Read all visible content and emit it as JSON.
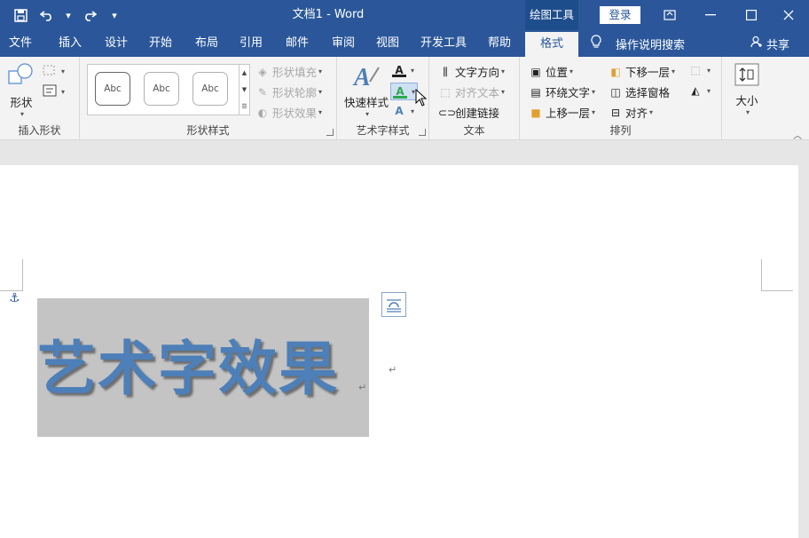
{
  "titlebar": {
    "doc_title": "文档1  -  Word",
    "context_tab": "绘图工具",
    "login": "登录"
  },
  "tabs": [
    "文件",
    "插入",
    "设计",
    "开始",
    "布局",
    "引用",
    "邮件",
    "审阅",
    "视图",
    "开发工具",
    "帮助",
    "格式"
  ],
  "active_tab": "格式",
  "tell_me": "操作说明搜索",
  "share": "共享",
  "ribbon": {
    "insert_shapes": {
      "shapes_label": "形状",
      "group_label": "插入形状"
    },
    "shape_styles": {
      "gallery": [
        "Abc",
        "Abc",
        "Abc"
      ],
      "fill": "形状填充",
      "outline": "形状轮廓",
      "effects": "形状效果",
      "group_label": "形状样式"
    },
    "wordart": {
      "quick_styles": "快速样式",
      "group_label": "艺术字样式"
    },
    "text": {
      "direction": "文字方向",
      "align": "对齐文本",
      "link": "创建链接",
      "group_label": "文本"
    },
    "arrange": {
      "position": "位置",
      "wrap": "环绕文字",
      "forward": "上移一层",
      "backward": "下移一层",
      "selection_pane": "选择窗格",
      "align": "对齐",
      "group_label": "排列"
    },
    "size": {
      "label": "大小"
    }
  },
  "document": {
    "wordart_text": "艺术字效果",
    "para_mark": "↵"
  },
  "colors": {
    "titlebar": "#2b579a",
    "wordart_fill": "#4d7fb8",
    "selection_bg": "#c4c4c4"
  }
}
